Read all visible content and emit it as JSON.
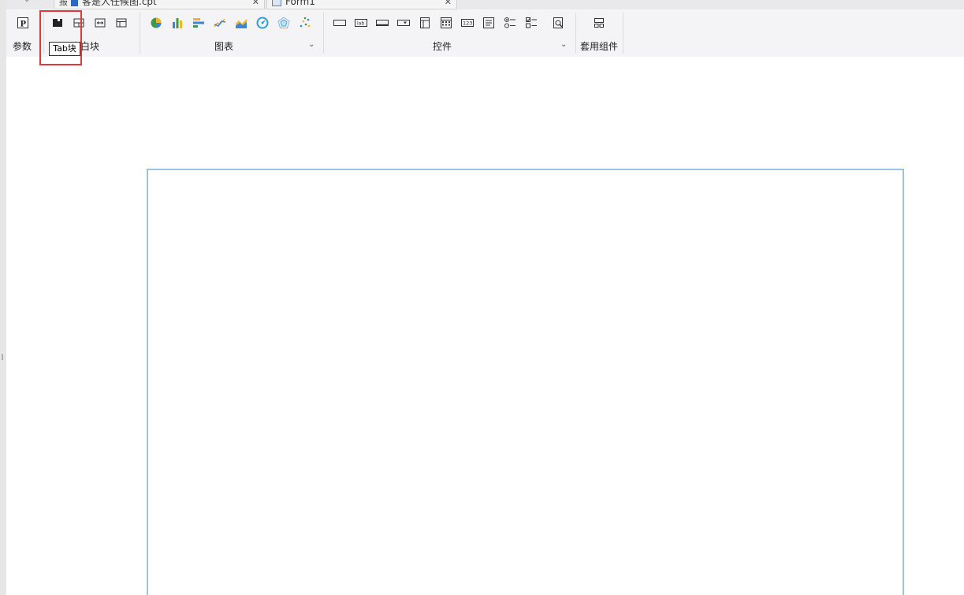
{
  "tabs": [
    {
      "label": "客是人任候图.cpt",
      "prefix": "报"
    },
    {
      "label": "Form1"
    }
  ],
  "toolbar": {
    "groups": [
      {
        "label": "参数",
        "tools": [
          "param-icon"
        ]
      },
      {
        "label": "空白块",
        "tools": [
          "tab-block-icon",
          "absolute-block-icon",
          "horizontal-block-icon",
          "layout-block-icon"
        ]
      },
      {
        "label": "图表",
        "tools": [
          "pie-chart-icon",
          "bar-chart-icon",
          "horizontal-bar-icon",
          "line-chart-icon",
          "area-chart-icon",
          "gauge-chart-icon",
          "radar-chart-icon",
          "scatter-chart-icon"
        ]
      },
      {
        "label": "控件",
        "tools": [
          "label-widget-icon",
          "text-widget-icon",
          "button-widget-icon",
          "combo-widget-icon",
          "date-widget-icon",
          "calendar-widget-icon",
          "number-widget-icon",
          "textarea-widget-icon",
          "radio-widget-icon",
          "checkbox-widget-icon",
          "search-widget-icon"
        ]
      },
      {
        "label": "套用组件",
        "tools": [
          "template-component-icon"
        ]
      }
    ],
    "label_widget_text": "lab",
    "number_widget_text": "123"
  },
  "tooltip": {
    "text": "Tab块"
  },
  "colors": {
    "highlight": "#e0393b",
    "canvas_border": "#9cc3e6",
    "toolbar_bg": "#f4f4f6"
  }
}
